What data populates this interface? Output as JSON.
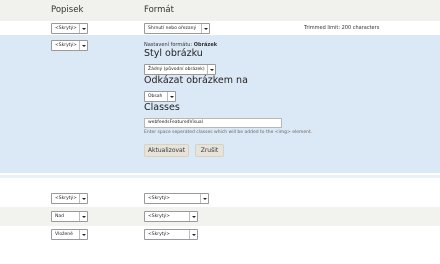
{
  "header": {
    "col_caption": "Popisek",
    "col_format": "Formát"
  },
  "rows": {
    "row1": {
      "caption_select": "<Skrytý>",
      "format_select": "Shrnutí nebo ořezaný",
      "summary": "Trimmed limit: 200 characters"
    },
    "edit": {
      "caption_select": "<Skrytý>",
      "format_prefix": "Nastavení formátu: ",
      "format_name": "Obrázek",
      "style_heading": "Styl obrázku",
      "style_select": "Žádný (původní obrázek)",
      "link_heading": "Odkázat obrázkem na",
      "link_select": "Obsah",
      "classes_heading": "Classes",
      "classes_value": "webfeedsFeaturedVisual",
      "classes_help": "Enter space seperated classes which will be added to the <img> element.",
      "update_label": "Aktualizovat",
      "cancel_label": "Zrušit"
    },
    "row3": {
      "caption_select": "<Skrytý>",
      "format_select": "<Skrytý>"
    },
    "row4": {
      "caption_select": "Nad",
      "format_select": "<Skrytý>"
    },
    "row5": {
      "caption_select": "Vložené",
      "format_select": "<Skrytý>"
    }
  }
}
